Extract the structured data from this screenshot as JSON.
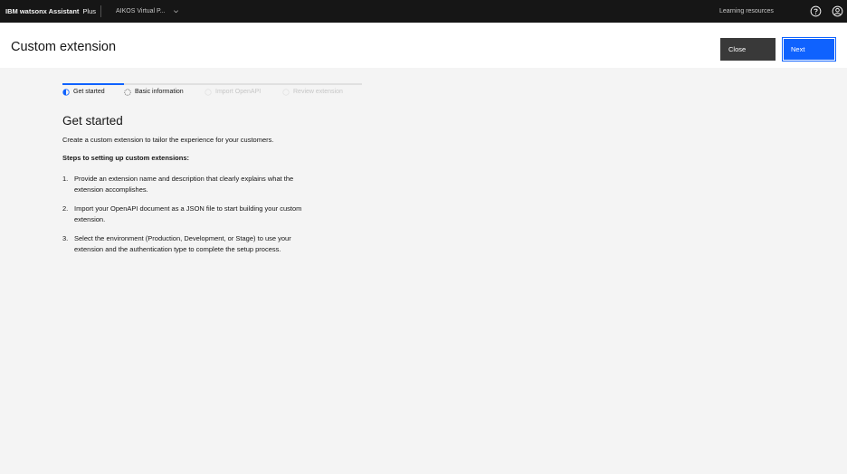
{
  "topbar": {
    "brand_name": "IBM watsonx Assistant",
    "brand_plan": "Plus",
    "instance_name": "AIKOS Virtual P...",
    "learning_resources": "Learning resources",
    "help_icon": "help-icon",
    "user_icon": "user-avatar-icon"
  },
  "header": {
    "title": "Custom extension",
    "close_label": "Close",
    "next_label": "Next"
  },
  "progress": {
    "steps": [
      {
        "label": "Get started",
        "state": "current"
      },
      {
        "label": "Basic information",
        "state": "incomplete"
      },
      {
        "label": "Import OpenAPI",
        "state": "disabled"
      },
      {
        "label": "Review extension",
        "state": "disabled"
      }
    ]
  },
  "content": {
    "heading": "Get started",
    "intro": "Create a custom extension to tailor the experience for your customers.",
    "steps_heading": "Steps to setting up custom extensions:",
    "items": [
      {
        "num": "1.",
        "text": "Provide an extension name and description that clearly explains what the extension accomplishes."
      },
      {
        "num": "2.",
        "text": "Import your OpenAPI document as a JSON file to start building your custom extension."
      },
      {
        "num": "3.",
        "text": "Select the environment (Production, Development, or Stage) to use your extension and the authentication type to complete the setup process."
      }
    ]
  },
  "colors": {
    "topbar_bg": "#161616",
    "primary": "#0f62fe",
    "secondary_button": "#393939",
    "page_bg": "#f4f4f4"
  }
}
